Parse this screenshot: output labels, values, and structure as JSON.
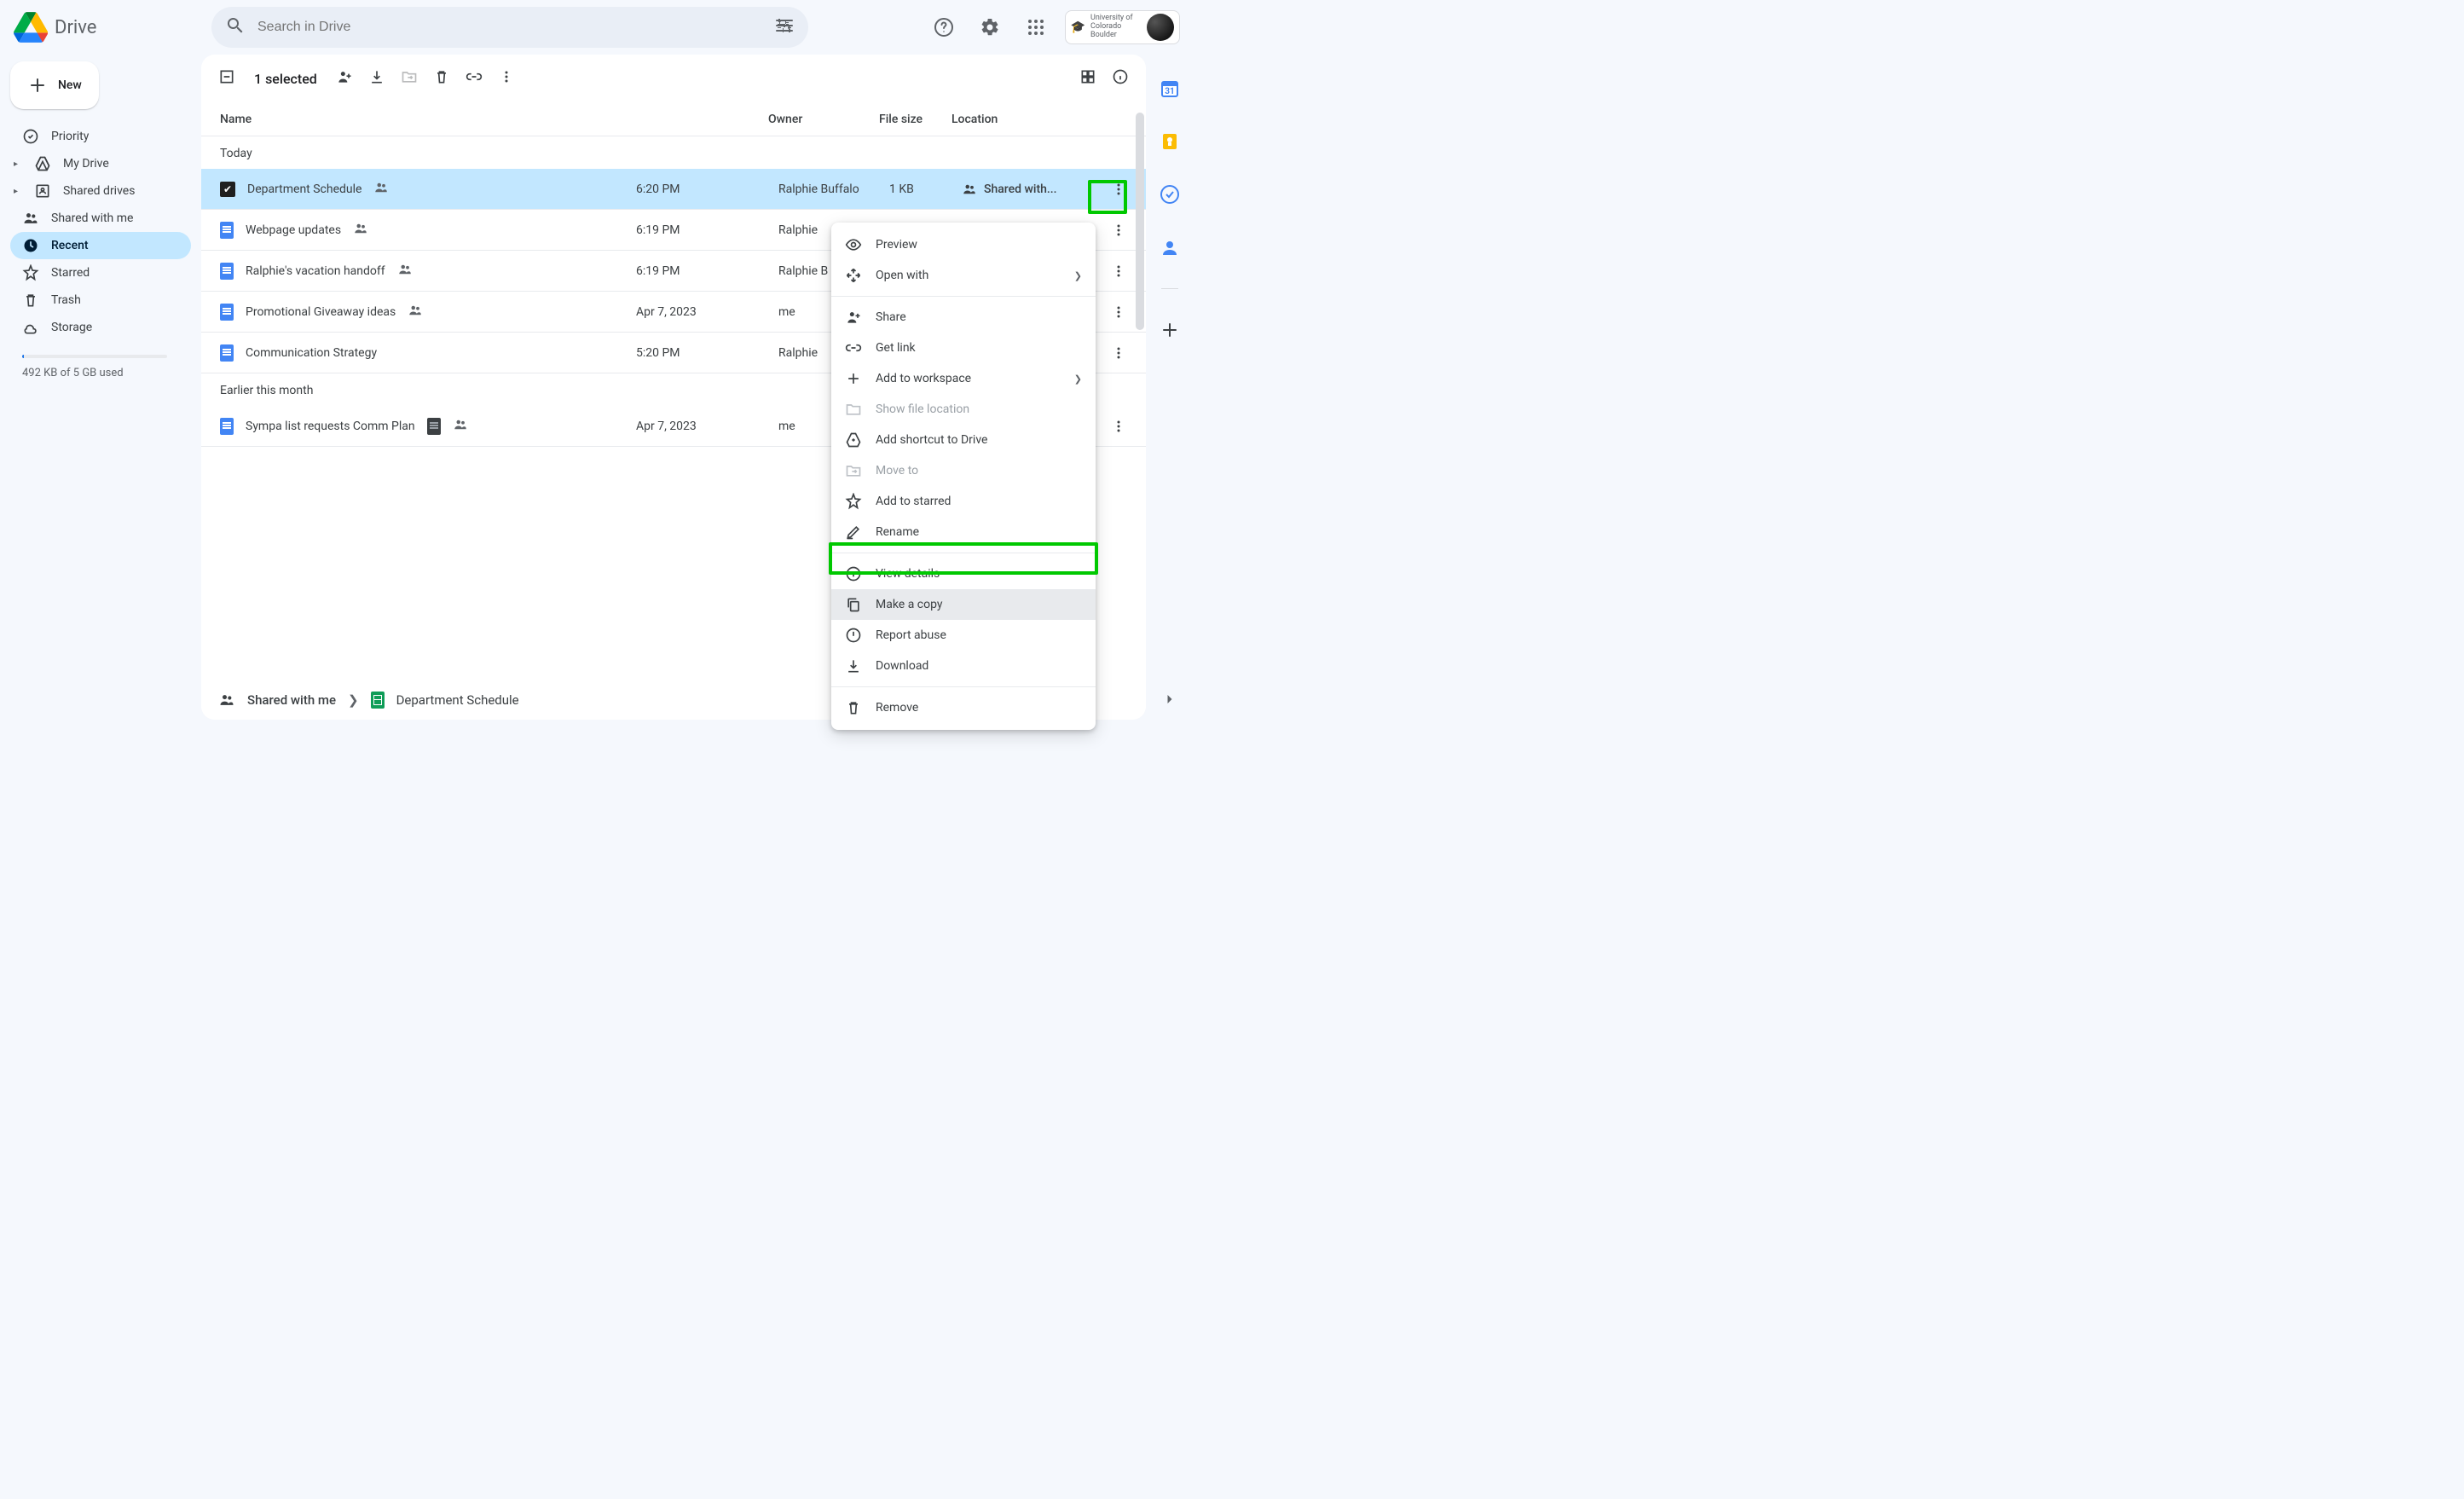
{
  "app": {
    "name": "Drive"
  },
  "search": {
    "placeholder": "Search in Drive"
  },
  "org": {
    "label": "University of Colorado Boulder"
  },
  "new_button": {
    "label": "New"
  },
  "nav": {
    "priority": "Priority",
    "my_drive": "My Drive",
    "shared_drives": "Shared drives",
    "shared_with_me": "Shared with me",
    "recent": "Recent",
    "starred": "Starred",
    "trash": "Trash",
    "storage": "Storage"
  },
  "storage": {
    "used_label": "492 KB of 5 GB used"
  },
  "toolbar": {
    "selected_label": "1 selected"
  },
  "columns": {
    "name": "Name",
    "owner": "Owner",
    "size": "File size",
    "location": "Location"
  },
  "sections": {
    "today": "Today",
    "earlier": "Earlier this month"
  },
  "rows": [
    {
      "name": "Department Schedule",
      "shared": true,
      "time": "6:20 PM",
      "owner": "Ralphie Buffalo",
      "size": "1 KB",
      "location": "Shared with...",
      "selected": true,
      "icon": "checkbox"
    },
    {
      "name": "Webpage updates",
      "shared": true,
      "time": "6:19 PM",
      "owner": "Ralphie",
      "icon": "doc"
    },
    {
      "name": "Ralphie's vacation handoff",
      "shared": true,
      "time": "6:19 PM",
      "owner": "Ralphie B",
      "icon": "doc"
    },
    {
      "name": "Promotional Giveaway ideas",
      "shared": true,
      "time": "Apr 7, 2023",
      "owner": "me",
      "icon": "doc"
    },
    {
      "name": "Communication Strategy",
      "shared": false,
      "time": "5:20 PM",
      "owner": "Ralphie",
      "icon": "doc"
    }
  ],
  "rows_earlier": [
    {
      "name": "Sympa list requests Comm Plan",
      "shared": true,
      "dark": true,
      "time": "Apr 7, 2023",
      "owner": "me",
      "icon": "dark"
    }
  ],
  "context_menu": {
    "preview": "Preview",
    "open_with": "Open with",
    "share": "Share",
    "get_link": "Get link",
    "add_workspace": "Add to workspace",
    "show_location": "Show file location",
    "add_shortcut": "Add shortcut to Drive",
    "move_to": "Move to",
    "add_starred": "Add to starred",
    "rename": "Rename",
    "view_details": "View details",
    "make_copy": "Make a copy",
    "report_abuse": "Report abuse",
    "download": "Download",
    "remove": "Remove"
  },
  "breadcrumb": {
    "root": "Shared with me",
    "current": "Department Schedule"
  }
}
